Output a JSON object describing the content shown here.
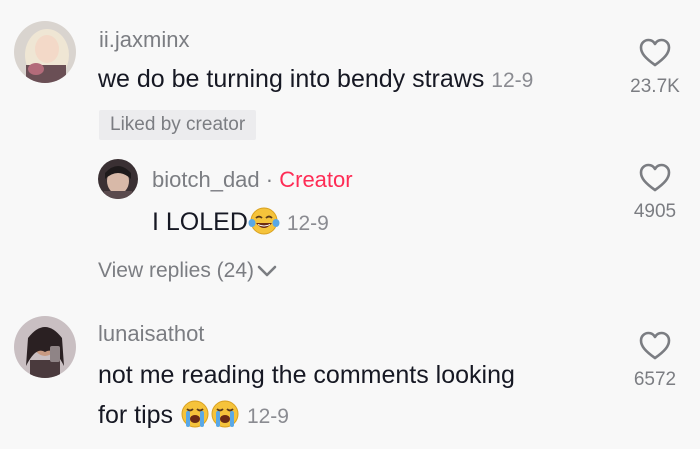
{
  "comments": [
    {
      "username": "ii.jaxminx",
      "text": "we do be turning into bendy straws",
      "date": "12-9",
      "likes": "23.7K",
      "badge": "Liked by creator"
    },
    {
      "username": "biotch_dad",
      "separator": "·",
      "role": "Creator",
      "text": "I LOLED",
      "emoji": "tears-of-joy-emoji",
      "date": "12-9",
      "likes": "4905"
    },
    {
      "username": "lunaisathot",
      "text_line1": "not me reading the comments looking",
      "text_line2": "for tips",
      "emoji": "loudly-crying-emoji",
      "date": "12-9",
      "likes": "6572"
    }
  ],
  "view_replies": {
    "label": "View replies (24)",
    "icon": "chevron-down-icon"
  },
  "colors": {
    "background": "#f8f8f8",
    "text_primary": "#161823",
    "text_secondary": "#7b7d82",
    "creator_accent": "#fe2c55"
  }
}
